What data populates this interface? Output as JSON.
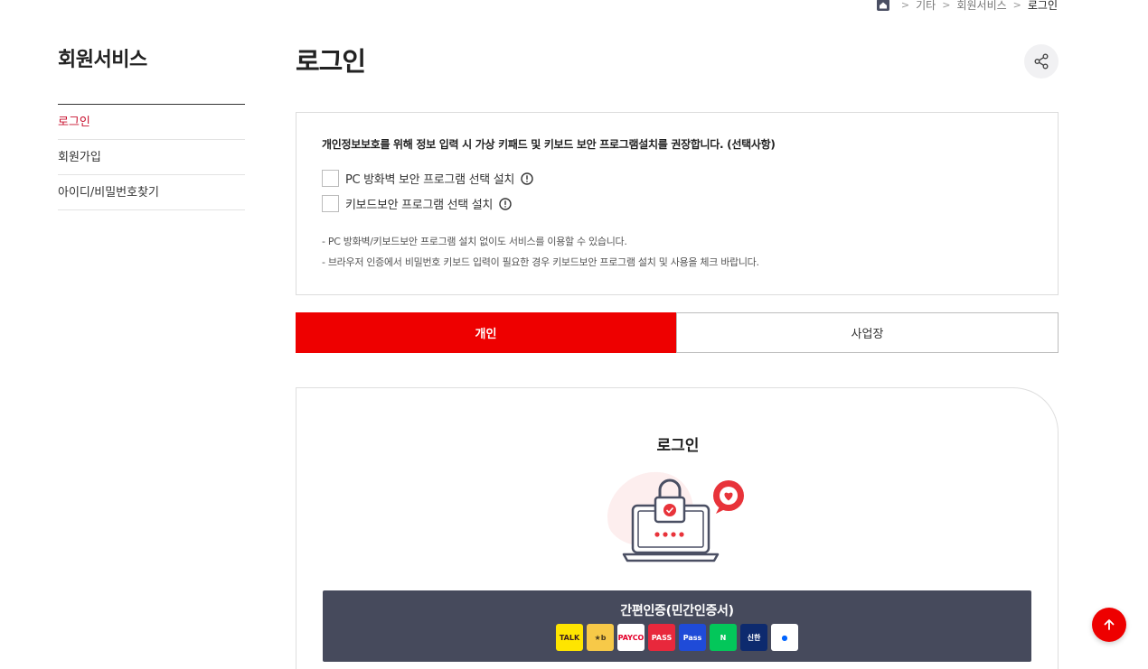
{
  "breadcrumb": {
    "home_icon": "home-icon",
    "items": [
      "기타",
      "회원서비스",
      "로그인"
    ]
  },
  "sidebar": {
    "title": "회원서비스",
    "items": [
      {
        "label": "로그인",
        "active": true
      },
      {
        "label": "회원가입",
        "active": false
      },
      {
        "label": "아이디/비밀번호찾기",
        "active": false
      }
    ]
  },
  "main": {
    "title": "로그인",
    "share_icon": "share-icon"
  },
  "notice": {
    "title": "개인정보보호를 위해 정보 입력 시 가상 키패드 및 키보드 보안 프로그램설치를 권장합니다. (선택사항)",
    "options": [
      {
        "label": "PC 방화벽 보안 프로그램 선택 설치",
        "checked": false
      },
      {
        "label": "키보드보안 프로그램 선택 설치",
        "checked": false
      }
    ],
    "notes": [
      "-  PC 방화벽/키보드보안 프로그램 설치 없이도 서비스를 이용할 수 있습니다.",
      "-  브라우저 인증에서 비밀번호 키보드 입력이 필요한 경우 키보드보안 프로그램 설치 및 사용을 체크 바랍니다."
    ]
  },
  "tabs": {
    "personal": "개인",
    "business": "사업장",
    "active": "personal"
  },
  "login_card": {
    "title": "로그인",
    "easy_auth_label": "간편인증(민간인증서)",
    "providers": [
      {
        "name": "kakao",
        "text": "TALK",
        "bg": "#fee500",
        "fg": "#3c1e1e"
      },
      {
        "name": "kb",
        "text": "★b",
        "bg": "#f7c948",
        "fg": "#4a3b1e"
      },
      {
        "name": "payco",
        "text": "PAYCO",
        "bg": "#ffffff",
        "fg": "#e4002b"
      },
      {
        "name": "pass",
        "text": "PASS",
        "bg": "#e8283c",
        "fg": "#ffffff"
      },
      {
        "name": "samsung-pass",
        "text": "Pass",
        "bg": "#1f4bd8",
        "fg": "#ffffff"
      },
      {
        "name": "naver",
        "text": "N",
        "bg": "#03c75a",
        "fg": "#ffffff"
      },
      {
        "name": "shinhan",
        "text": "신한",
        "bg": "#0d2a6e",
        "fg": "#ffffff"
      },
      {
        "name": "toss",
        "text": "●",
        "bg": "#ffffff",
        "fg": "#0064ff"
      }
    ]
  },
  "colors": {
    "accent": "#ee0000",
    "active_nav": "#c8102e",
    "dark_button": "#464a5c"
  }
}
